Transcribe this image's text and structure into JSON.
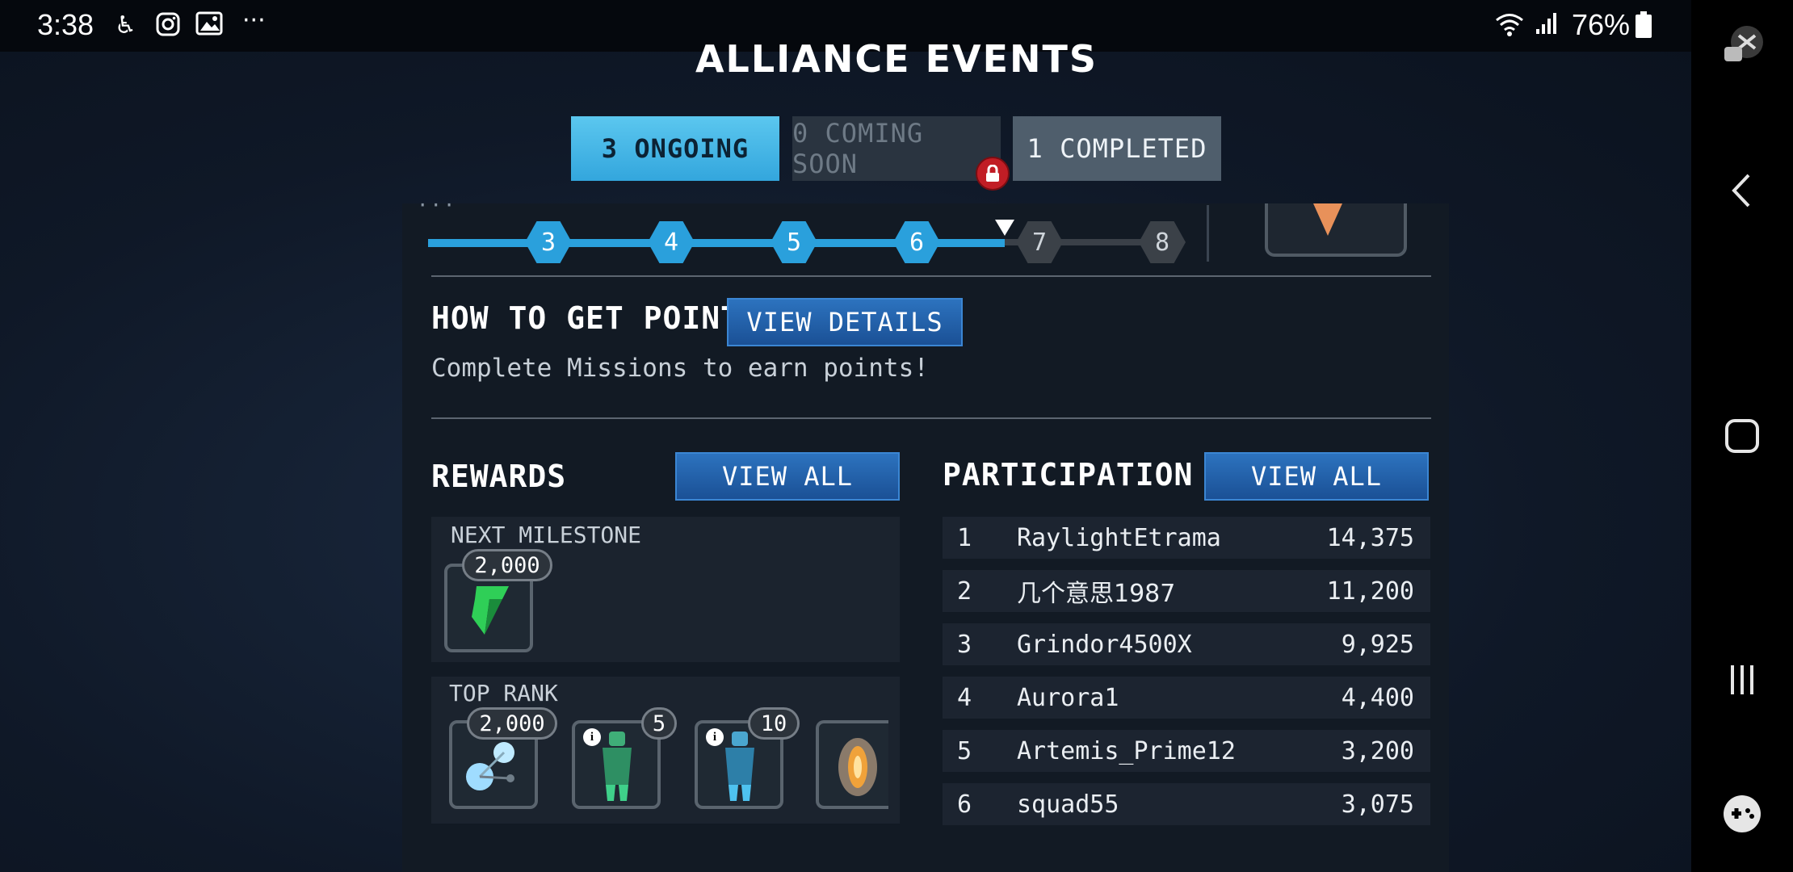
{
  "status_bar": {
    "time": "3:38",
    "left_icons": [
      "accessibility-icon",
      "instagram-icon",
      "gallery-icon",
      "more-icon"
    ],
    "battery": "76%"
  },
  "screen": {
    "title": "ALLIANCE EVENTS",
    "tabs": [
      {
        "label": "3 ONGOING",
        "state": "active"
      },
      {
        "label": "0 COMING SOON",
        "state": "locked"
      },
      {
        "label": "1 COMPLETED",
        "state": "normal"
      }
    ],
    "milestones": {
      "nodes": [
        "3",
        "4",
        "5",
        "6",
        "7",
        "8"
      ],
      "completed_count": 4
    },
    "how_to": {
      "heading": "HOW TO GET POINTS",
      "button": "VIEW DETAILS",
      "description": "Complete Missions to earn points!"
    },
    "rewards": {
      "heading": "REWARDS",
      "button": "VIEW ALL",
      "next_milestone": {
        "label": "NEXT MILESTONE",
        "items": [
          {
            "icon": "green-shard-icon",
            "badge": "2,000"
          }
        ]
      },
      "top_rank": {
        "label": "TOP RANK",
        "items": [
          {
            "icon": "energy-orbs-icon",
            "badge": "2,000"
          },
          {
            "icon": "green-armor-icon",
            "badge": "5"
          },
          {
            "icon": "blue-armor-icon",
            "badge": "10"
          },
          {
            "icon": "orange-capsule-icon",
            "badge": ""
          }
        ]
      }
    },
    "participation": {
      "heading": "PARTICIPATION",
      "button": "VIEW ALL",
      "rows": [
        {
          "rank": "1",
          "name": "RaylightEtrama",
          "score": "14,375"
        },
        {
          "rank": "2",
          "name": "几个意思1987",
          "score": "11,200"
        },
        {
          "rank": "3",
          "name": "Grindor4500X",
          "score": "9,925"
        },
        {
          "rank": "4",
          "name": "Aurora1",
          "score": "4,400"
        },
        {
          "rank": "5",
          "name": "Artemis_Prime12",
          "score": "3,200"
        },
        {
          "rank": "6",
          "name": "squad55",
          "score": "3,075"
        }
      ]
    }
  },
  "colors": {
    "accent_blue": "#2aa0dc",
    "button_blue": "#2d74c0",
    "lock_red": "#c11d25"
  }
}
